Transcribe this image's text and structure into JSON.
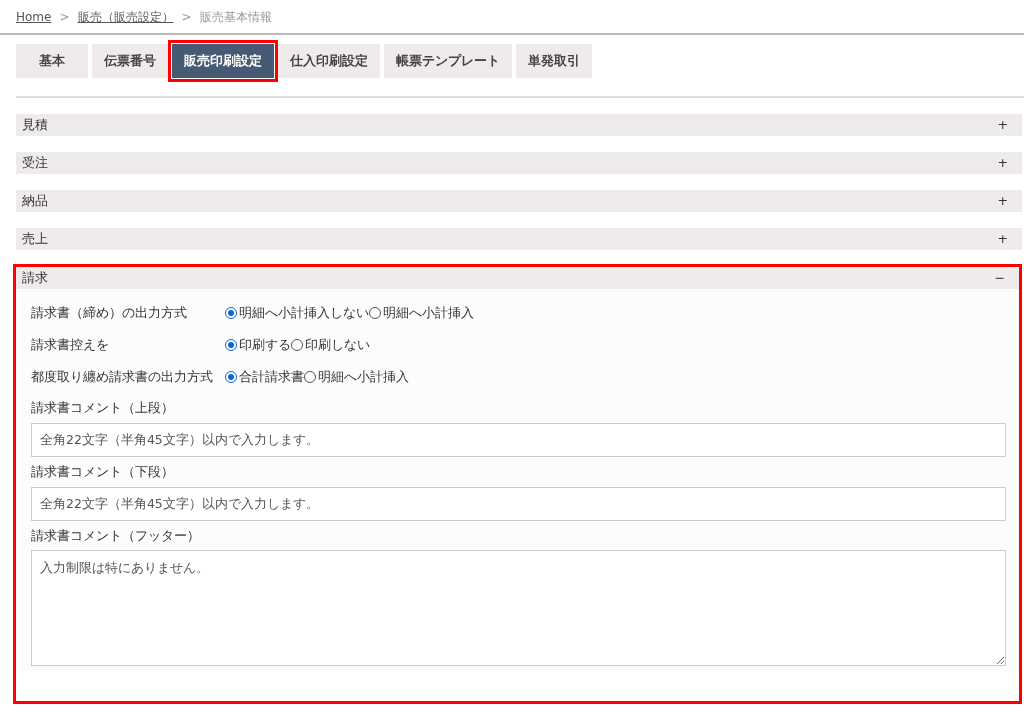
{
  "breadcrumb": [
    {
      "label": "Home",
      "link": true
    },
    {
      "label": "販売（販売設定）",
      "link": true
    },
    {
      "label": "販売基本情報",
      "link": false
    }
  ],
  "breadcrumb_separator": ">",
  "tabs": [
    {
      "label": "基本",
      "selected": false,
      "highlighted": false
    },
    {
      "label": "伝票番号",
      "selected": false,
      "highlighted": false
    },
    {
      "label": "販売印刷設定",
      "selected": true,
      "highlighted": true
    },
    {
      "label": "仕入印刷設定",
      "selected": false,
      "highlighted": false
    },
    {
      "label": "帳票テンプレート",
      "selected": false,
      "highlighted": false
    },
    {
      "label": "単発取引",
      "selected": false,
      "highlighted": false
    }
  ],
  "sections": [
    {
      "title": "見積",
      "toggle": "+",
      "expanded": false,
      "highlighted": false
    },
    {
      "title": "受注",
      "toggle": "+",
      "expanded": false,
      "highlighted": false
    },
    {
      "title": "納品",
      "toggle": "+",
      "expanded": false,
      "highlighted": false
    },
    {
      "title": "売上",
      "toggle": "+",
      "expanded": false,
      "highlighted": false
    },
    {
      "title": "請求",
      "toggle": "−",
      "expanded": true,
      "highlighted": true,
      "fields": [
        {
          "kind": "radio",
          "label": "請求書（締め）の出力方式",
          "options": [
            {
              "label": "明細へ小計挿入しない",
              "selected": true
            },
            {
              "label": "明細へ小計挿入",
              "selected": false
            }
          ]
        },
        {
          "kind": "radio",
          "label": "請求書控えを",
          "options": [
            {
              "label": "印刷する",
              "selected": true
            },
            {
              "label": "印刷しない",
              "selected": false
            }
          ]
        },
        {
          "kind": "radio",
          "label": "都度取り纏め請求書の出力方式",
          "options": [
            {
              "label": "合計請求書",
              "selected": true
            },
            {
              "label": "明細へ小計挿入",
              "selected": false
            }
          ]
        },
        {
          "kind": "text",
          "label": "請求書コメント（上段）",
          "placeholder": "全角22文字（半角45文字）以内で入力します。"
        },
        {
          "kind": "text",
          "label": "請求書コメント（下段）",
          "placeholder": "全角22文字（半角45文字）以内で入力します。"
        },
        {
          "kind": "textarea",
          "label": "請求書コメント（フッター）",
          "placeholder": "入力制限は特にありません。"
        }
      ]
    }
  ]
}
